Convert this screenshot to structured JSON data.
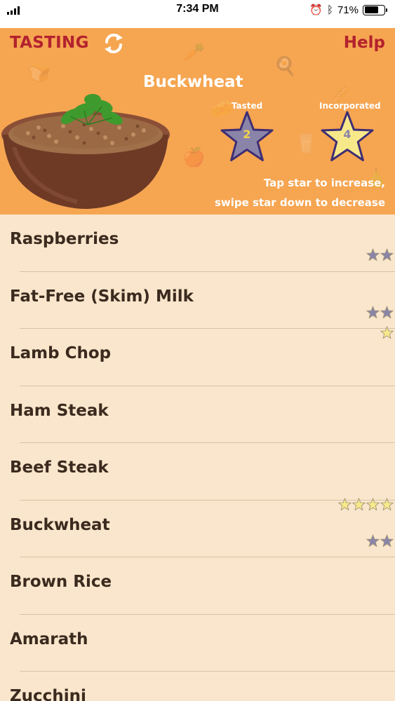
{
  "status_bar": {
    "time": "7:34 PM",
    "battery_percent": "71%",
    "battery_level": 0.71
  },
  "header": {
    "title": "TASTING",
    "help_label": "Help",
    "food_name": "Buckwheat",
    "tasted": {
      "label": "Tasted",
      "count": "2"
    },
    "incorporated": {
      "label": "Incorporated",
      "count": "4"
    },
    "hint_line1": "Tap star to increase,",
    "hint_line2": "swipe star down to decrease"
  },
  "colors": {
    "header_bg": "#f6a551",
    "accent_red": "#b3222d",
    "list_bg": "#f9e6cc",
    "tasted_star": "#8a84a8",
    "incorporated_star": "#f7e98a",
    "text_dark": "#3b2a1e"
  },
  "foods": [
    {
      "name": "Raspberries",
      "incorporated": 0,
      "tasted": 2
    },
    {
      "name": "Fat-Free (Skim) Milk",
      "incorporated": 0,
      "tasted": 2
    },
    {
      "name": "Lamb Chop",
      "incorporated": 1,
      "tasted": 0
    },
    {
      "name": "Ham Steak",
      "incorporated": 0,
      "tasted": 0
    },
    {
      "name": "Beef Steak",
      "incorporated": 0,
      "tasted": 0
    },
    {
      "name": "Buckwheat",
      "incorporated": 4,
      "tasted": 2
    },
    {
      "name": "Brown Rice",
      "incorporated": 0,
      "tasted": 0
    },
    {
      "name": "Amarath",
      "incorporated": 0,
      "tasted": 0
    },
    {
      "name": "Zucchini",
      "incorporated": 0,
      "tasted": 0
    }
  ]
}
